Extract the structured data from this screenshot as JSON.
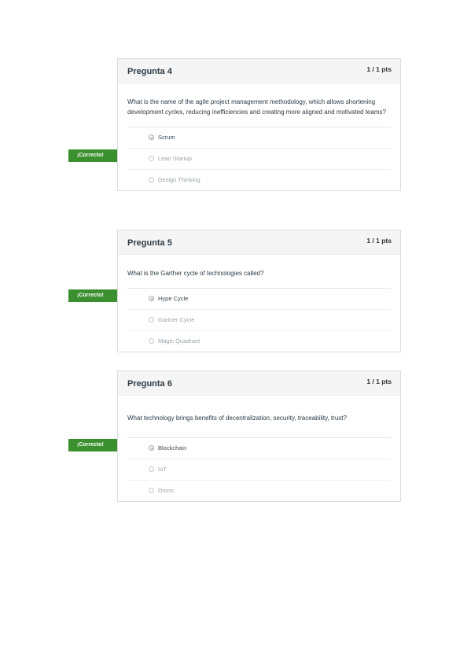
{
  "questions": [
    {
      "title": "Pregunta 4",
      "points": "1 / 1 pts",
      "text": "What is the name of the agile project management methodology, which allows shortening development cycles, reducing inefficiencies and creating more aligned and motivated teams?",
      "flag": "¡Correcto!",
      "answers": [
        {
          "label": "Scrum",
          "selected": true
        },
        {
          "label": "Lean Startup",
          "selected": false
        },
        {
          "label": "Design Thinking",
          "selected": false
        }
      ]
    },
    {
      "title": "Pregunta 5",
      "points": "1 / 1 pts",
      "text": "What is the Garther cycle of technologies called?",
      "flag": "¡Correcto!",
      "answers": [
        {
          "label": "Hype Cycle",
          "selected": true
        },
        {
          "label": "Gartner Cycle",
          "selected": false
        },
        {
          "label": "Magic Quadrant",
          "selected": false
        }
      ]
    },
    {
      "title": "Pregunta 6",
      "points": "1 / 1 pts",
      "text": "What technology brings benefits of decentralization, security, traceability, trust?",
      "flag": "¡Correcto!",
      "answers": [
        {
          "label": "Blockchain",
          "selected": true
        },
        {
          "label": "IoT",
          "selected": false
        },
        {
          "label": "Drons",
          "selected": false
        }
      ]
    }
  ],
  "colors": {
    "correct_flag": "#3a8f2e",
    "header_bg": "#f5f5f5",
    "border": "#d8dbdd"
  }
}
